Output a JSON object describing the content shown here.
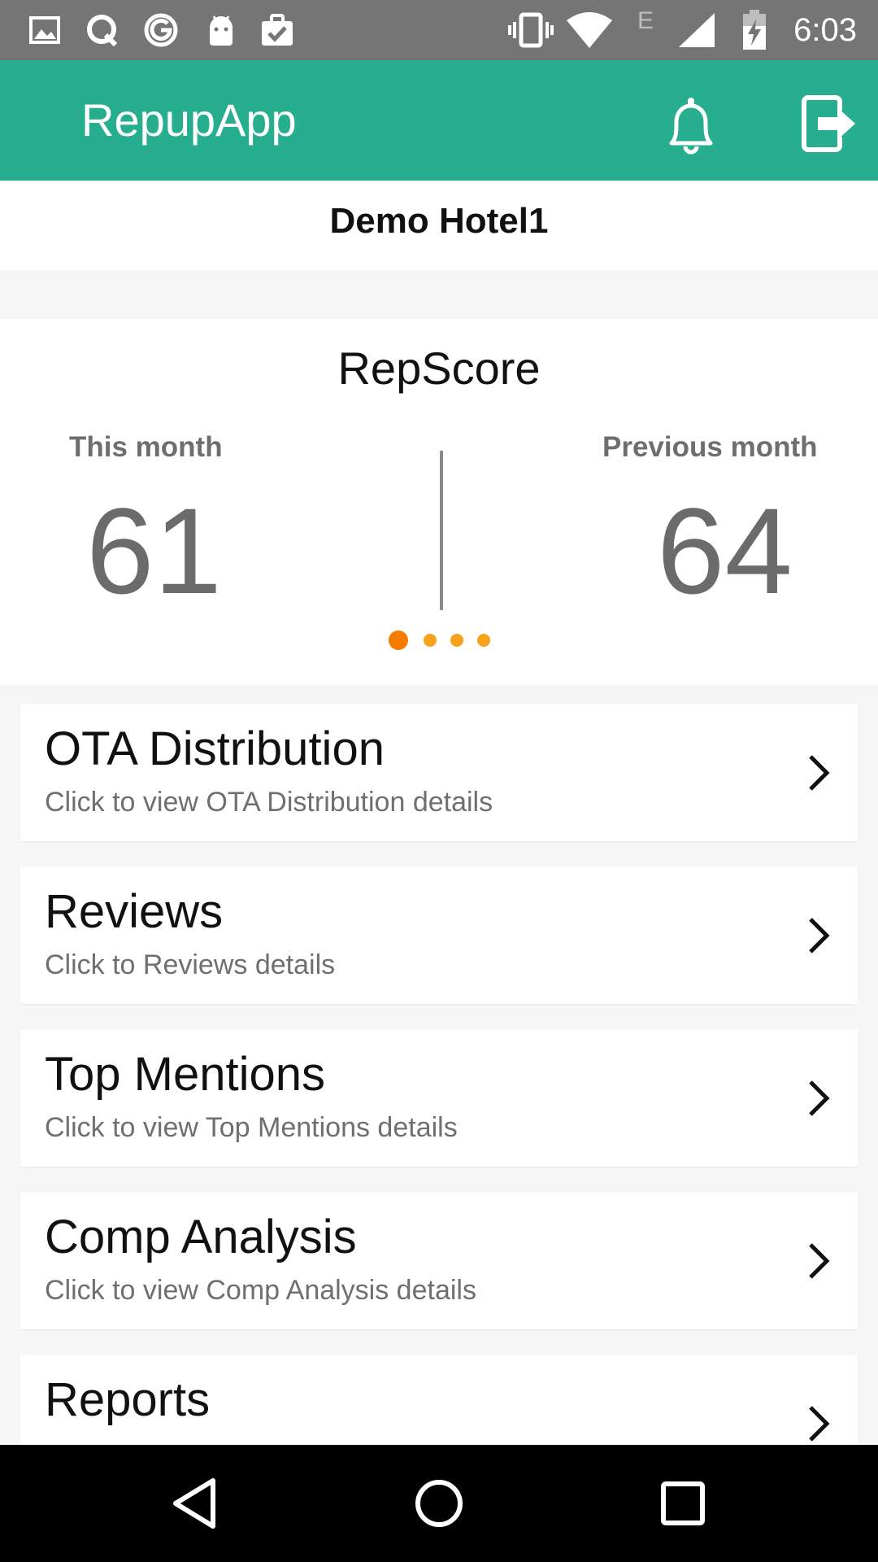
{
  "status_bar": {
    "time": "6:03",
    "network_label": "E",
    "left_icons": [
      "image-icon",
      "q-app-icon",
      "g-app-icon",
      "android-icon",
      "clipboard-check-icon"
    ],
    "right_icons": [
      "vibrate-icon",
      "wifi-icon",
      "signal-icon",
      "battery-charging-icon"
    ]
  },
  "app_bar": {
    "title": "RepupApp",
    "actions": [
      "bell-icon",
      "logout-icon"
    ],
    "color": "#26ae8f"
  },
  "hotel": {
    "name": "Demo Hotel1"
  },
  "repscore": {
    "title": "RepScore",
    "this_month_label": "This month",
    "this_month_value": "61",
    "previous_month_label": "Previous month",
    "previous_month_value": "64",
    "pager": {
      "count": 4,
      "active_index": 0,
      "active_color": "#f57c00",
      "inactive_color": "#f7a21c"
    }
  },
  "menu": [
    {
      "title": "OTA Distribution",
      "subtitle": "Click to view OTA Distribution details"
    },
    {
      "title": "Reviews",
      "subtitle": "Click to Reviews details"
    },
    {
      "title": "Top Mentions",
      "subtitle": "Click to view Top Mentions details"
    },
    {
      "title": "Comp Analysis",
      "subtitle": "Click to view Comp Analysis details"
    },
    {
      "title": "Reports",
      "subtitle": ""
    }
  ],
  "nav_bar": {
    "buttons": [
      "back-icon",
      "home-icon",
      "recents-icon"
    ]
  }
}
